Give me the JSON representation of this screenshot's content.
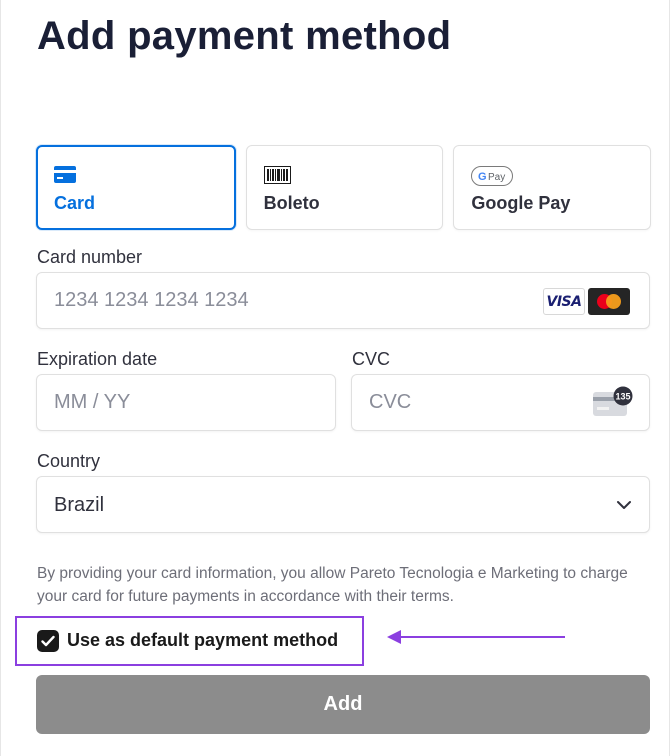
{
  "page": {
    "title": "Add payment method"
  },
  "tabs": [
    {
      "label": "Card",
      "icon": "card-icon",
      "selected": true
    },
    {
      "label": "Boleto",
      "icon": "barcode-icon",
      "selected": false
    },
    {
      "label": "Google Pay",
      "icon": "google-pay-icon",
      "selected": false,
      "badge": "G Pay"
    }
  ],
  "card_number": {
    "label": "Card number",
    "placeholder": "1234 1234 1234 1234",
    "value": "",
    "brands": [
      "VISA",
      "mastercard"
    ]
  },
  "expiration": {
    "label": "Expiration date",
    "placeholder": "MM / YY",
    "value": ""
  },
  "cvc": {
    "label": "CVC",
    "placeholder": "CVC",
    "value": "",
    "icon_badge": "135"
  },
  "country": {
    "label": "Country",
    "value": "Brazil"
  },
  "legal_text": "By providing your card information, you allow Pareto Tecnologia e Marketing to charge your card for future payments in accordance with their terms.",
  "default_method": {
    "label": "Use as default payment method",
    "checked": true
  },
  "submit": {
    "label": "Add"
  },
  "colors": {
    "accent": "#0570de",
    "highlight": "#8b3fe0",
    "button_disabled": "#8c8c8c"
  }
}
